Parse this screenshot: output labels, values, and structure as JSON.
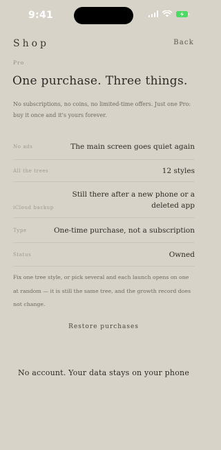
{
  "status_bar": {
    "time": "9:41",
    "icons": [
      "cellular-signal-icon",
      "wifi-icon",
      "battery-charging-icon"
    ],
    "battery_color": "#4cd964"
  },
  "nav": {
    "title": "Shop",
    "back_label": "Back"
  },
  "hero": {
    "eyebrow": "Pro",
    "headline": "One purchase. Three things.",
    "intro": "No subscriptions, no coins, no limited-time offers. Just one Pro: buy it once and it's yours forever."
  },
  "details": [
    {
      "label": "No ads",
      "value": "The main screen goes quiet again"
    },
    {
      "label": "All the trees",
      "value": "12 styles"
    },
    {
      "label": "iCloud backup",
      "value": "Still there after a new phone or a deleted app"
    },
    {
      "label": "Type",
      "value": "One-time purchase, not a subscription"
    },
    {
      "label": "Status",
      "value": "Owned"
    }
  ],
  "footnote": "Fix one tree style, or pick several and each launch opens on one at random — it is still the same tree, and the growth record does not change.",
  "restore_label": "Restore purchases",
  "privacy_note": "No account. Your data stays on your phone",
  "colors": {
    "background": "#d8d3c8",
    "text": "#2c2a26",
    "muted": "#9c998f",
    "divider": "#cac5b9"
  }
}
